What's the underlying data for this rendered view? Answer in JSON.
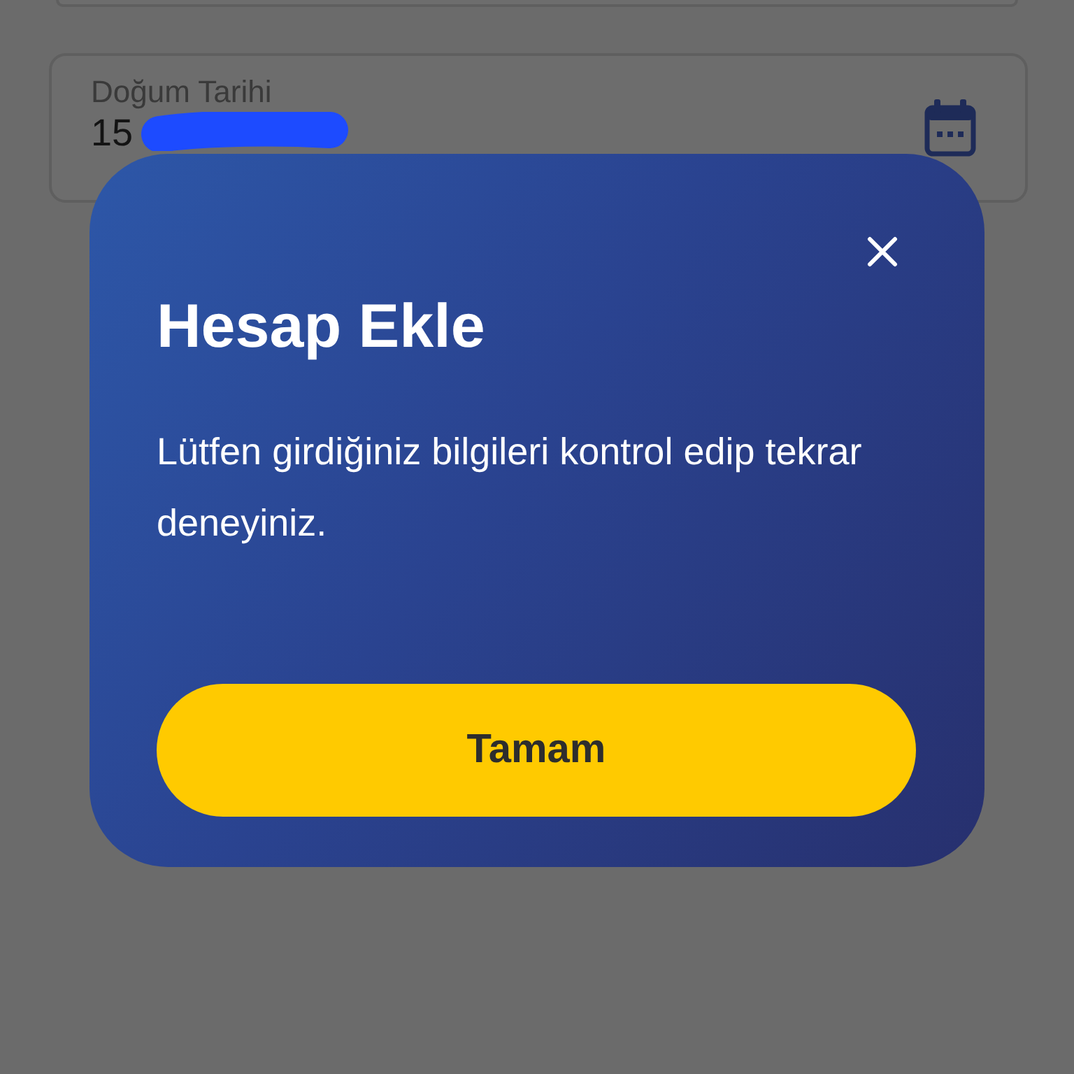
{
  "form": {
    "fields": [
      {
        "kind": "cut_off"
      },
      {
        "kind": "date",
        "label": "Doğum Tarihi",
        "value": "15",
        "redacted": true
      }
    ]
  },
  "dialog": {
    "title": "Hesap Ekle",
    "message": "Lütfen girdiğiniz bilgileri kontrol edip tekrar deneyiniz.",
    "buttons": [
      {
        "label": "Tamam",
        "kind": "primary"
      }
    ]
  }
}
